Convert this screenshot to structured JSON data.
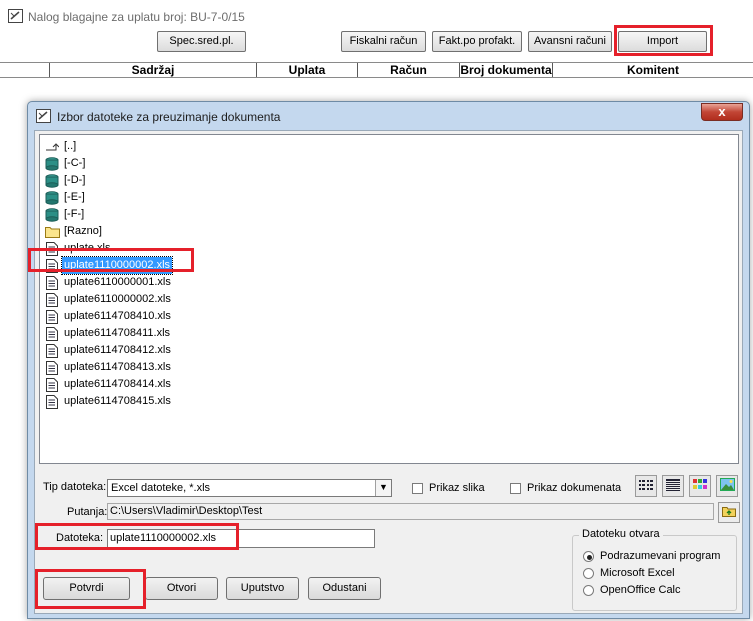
{
  "background_window": {
    "title": "Nalog blagajne za uplatu broj: BU-7-0/15",
    "toolbar": {
      "spec_label": "Spec.sred.pl.",
      "fiskalni_label": "Fiskalni račun",
      "fakt_label": "Fakt.po profakt.",
      "avansni_label": "Avansni računi",
      "import_label": "Import"
    },
    "grid_headers": [
      "Sadržaj",
      "Uplata",
      "Račun",
      "Broj dokumenta",
      "Komitent"
    ]
  },
  "dialog": {
    "title": "Izbor datoteke za preuzimanje dokumenta",
    "close_label": "x",
    "files": [
      {
        "label": "[..]",
        "icon": "folder-up-icon"
      },
      {
        "label": "[-C-]",
        "icon": "drive-icon"
      },
      {
        "label": "[-D-]",
        "icon": "drive-icon"
      },
      {
        "label": "[-E-]",
        "icon": "drive-icon"
      },
      {
        "label": "[-F-]",
        "icon": "drive-icon"
      },
      {
        "label": "[Razno]",
        "icon": "folder-icon"
      },
      {
        "label": "uplate.xls",
        "icon": "file-icon"
      },
      {
        "label": "uplate1110000002.xls",
        "icon": "file-icon",
        "selected": true
      },
      {
        "label": "uplate6110000001.xls",
        "icon": "file-icon"
      },
      {
        "label": "uplate6110000002.xls",
        "icon": "file-icon"
      },
      {
        "label": "uplate6114708410.xls",
        "icon": "file-icon"
      },
      {
        "label": "uplate6114708411.xls",
        "icon": "file-icon"
      },
      {
        "label": "uplate6114708412.xls",
        "icon": "file-icon"
      },
      {
        "label": "uplate6114708413.xls",
        "icon": "file-icon"
      },
      {
        "label": "uplate6114708414.xls",
        "icon": "file-icon"
      },
      {
        "label": "uplate6114708415.xls",
        "icon": "file-icon"
      }
    ],
    "tip_label": "Tip datoteka:",
    "tip_value": "Excel datoteke, *.xls",
    "prikaz_slika": "Prikaz slika",
    "prikaz_dokumenata": "Prikaz dokumenata",
    "putanja_label": "Putanja:",
    "putanja_value": "C:\\Users\\Vladimir\\Desktop\\Test",
    "datoteka_label": "Datoteka:",
    "datoteka_value": "uplate1110000002.xls",
    "opens_with": {
      "legend": "Datoteku otvara",
      "options": [
        "Podrazumevani program",
        "Microsoft Excel",
        "OpenOffice Calc"
      ],
      "selected": 0
    },
    "buttons": {
      "potvrdi": "Potvrdi",
      "otvori": "Otvori",
      "uputstvo": "Uputstvo",
      "odustani": "Odustani"
    }
  },
  "colors": {
    "highlight": "#e5202a",
    "selection": "#3399ff",
    "dialog_frame": "#c4d8ee"
  }
}
